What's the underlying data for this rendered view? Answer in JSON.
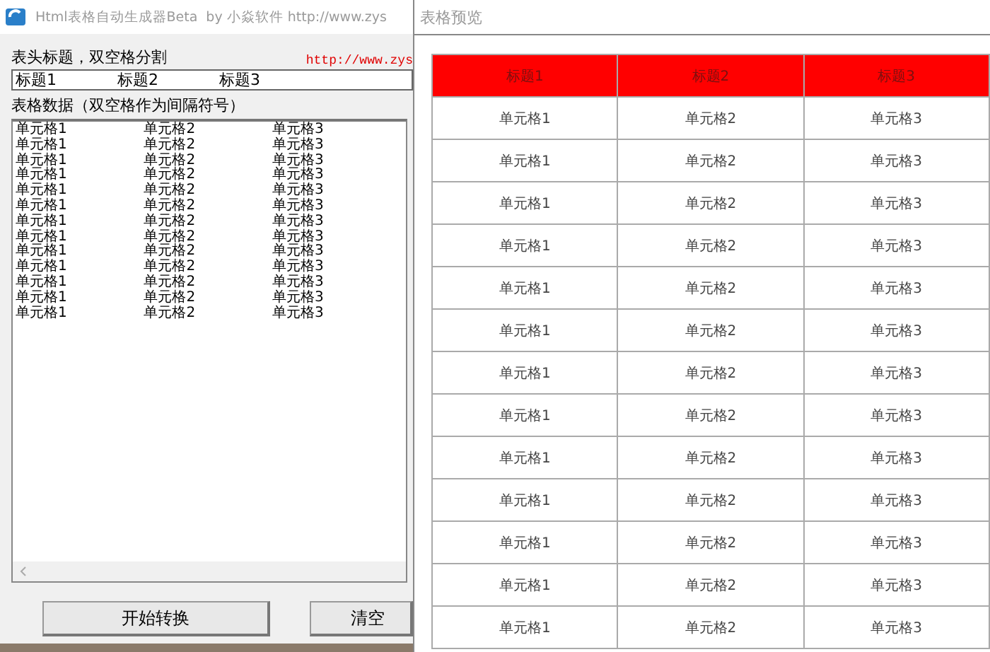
{
  "main_window": {
    "title": "Html表格自动生成器Beta",
    "byline": "by 小焱软件 http://www.zys",
    "header_label": "表头标题，双空格分割",
    "link": "http://www.zys",
    "header_field": {
      "value": "标题1  标题2  标题3"
    },
    "data_label": "表格数据（双空格作为间隔符号）",
    "data_field": {
      "lines": [
        "单元格1  单元格2  单元格3",
        "单元格1  单元格2  单元格3",
        "单元格1  单元格2  单元格3",
        "单元格1  单元格2  单元格3",
        "单元格1  单元格2  单元格3",
        "单元格1  单元格2  单元格3",
        "单元格1  单元格2  单元格3",
        "单元格1  单元格2  单元格3",
        "单元格1  单元格2  单元格3",
        "单元格1  单元格2  单元格3",
        "单元格1  单元格2  单元格3",
        "单元格1  单元格2  单元格3",
        "单元格1  单元格2  单元格3"
      ]
    },
    "buttons": [
      "开始转换",
      "清空"
    ]
  },
  "preview_window": {
    "title": "表格预览",
    "table": {
      "columns": [
        "标题1",
        "标题2",
        "标题3"
      ],
      "rows": [
        [
          "单元格1",
          "单元格2",
          "单元格3"
        ],
        [
          "单元格1",
          "单元格2",
          "单元格3"
        ],
        [
          "单元格1",
          "单元格2",
          "单元格3"
        ],
        [
          "单元格1",
          "单元格2",
          "单元格3"
        ],
        [
          "单元格1",
          "单元格2",
          "单元格3"
        ],
        [
          "单元格1",
          "单元格2",
          "单元格3"
        ],
        [
          "单元格1",
          "单元格2",
          "单元格3"
        ],
        [
          "单元格1",
          "单元格2",
          "单元格3"
        ],
        [
          "单元格1",
          "单元格2",
          "单元格3"
        ],
        [
          "单元格1",
          "单元格2",
          "单元格3"
        ],
        [
          "单元格1",
          "单元格2",
          "单元格3"
        ],
        [
          "单元格1",
          "单元格2",
          "单元格3"
        ],
        [
          "单元格1",
          "单元格2",
          "单元格3"
        ]
      ]
    }
  }
}
